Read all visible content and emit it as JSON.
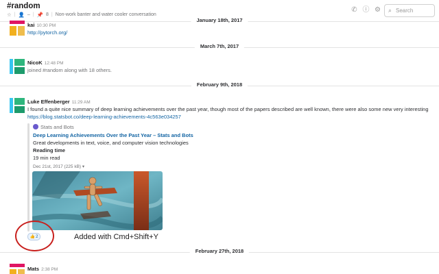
{
  "channel": {
    "name": "#random",
    "star_icon": "star-icon",
    "members_icon": "person-icon",
    "members_count": "–",
    "pins_icon": "pin-icon",
    "pins_count": "8",
    "purpose": "Non-work banter and water cooler conversation"
  },
  "header": {
    "icons": [
      "phone-icon",
      "info-icon",
      "gear-icon"
    ],
    "search_placeholder": "Search"
  },
  "dividers": [
    "January 18th, 2017",
    "March 7th, 2017",
    "February 9th, 2018",
    "February 27th, 2018"
  ],
  "messages": {
    "kai": {
      "name": "kai",
      "time": "10:30 PM",
      "link": "http://pytorch.org/"
    },
    "nicok": {
      "name": "NicoK",
      "time": "12:48 PM",
      "text": "joined #random along with 18 others."
    },
    "luke": {
      "name": "Luke Effenberger",
      "time": "11:29 AM",
      "text": "I found a quite nice summary of deep learning achievements over the past year, though most of the papers described are well known, there were also some new very interesting",
      "link": "https://blog.statsbot.co/deep-learning-achievements-4c563e034257",
      "attachment": {
        "service": "Stats and Bots",
        "title": "Deep Learning Achievements Over the Past Year – Stats and Bots",
        "description": "Great developments in text, voice, and computer vision technologies",
        "field_label": "Reading time",
        "field_value": "19 min read",
        "meta": "Dec 21st, 2017 (225 kB) ▾"
      },
      "reaction": {
        "emoji": "👍",
        "count": "2"
      }
    },
    "mats": {
      "name": "Mats",
      "time": "2:38 PM"
    }
  },
  "annotation": {
    "caption": "Added with Cmd+Shift+Y",
    "color": "#c8201d"
  },
  "colors": {
    "link": "#1264a3",
    "divider": "#e3e3e3",
    "accent_red": "#c8201d"
  }
}
